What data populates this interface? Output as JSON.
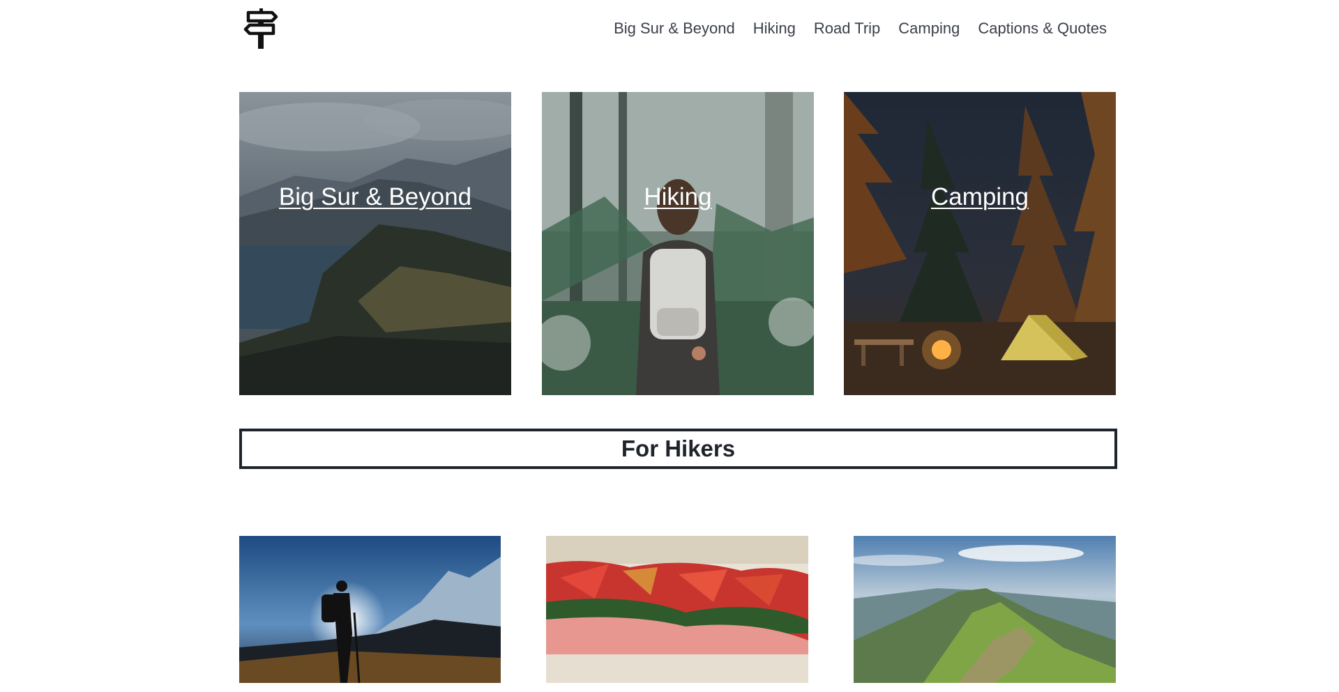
{
  "header": {
    "logo_icon": "signpost-icon",
    "nav": [
      {
        "label": "Big Sur & Beyond"
      },
      {
        "label": "Hiking"
      },
      {
        "label": "Road Trip"
      },
      {
        "label": "Camping"
      },
      {
        "label": "Captions & Quotes"
      }
    ]
  },
  "cards": [
    {
      "title": "Big Sur & Beyond",
      "image": "coastal-cliffs-photo"
    },
    {
      "title": "Hiking",
      "image": "hiker-in-forest-photo"
    },
    {
      "title": "Camping",
      "image": "campsite-at-night-photo"
    }
  ],
  "section": {
    "heading": "For Hikers"
  },
  "thumbnails": [
    {
      "image": "hiker-silhouette-mountains-photo"
    },
    {
      "image": "sandwich-closeup-photo"
    },
    {
      "image": "grassy-mountain-ridge-photo"
    }
  ],
  "colors": {
    "nav_text": "#3a3f48",
    "heading_border": "#1f232a",
    "card_title": "#ffffff"
  }
}
